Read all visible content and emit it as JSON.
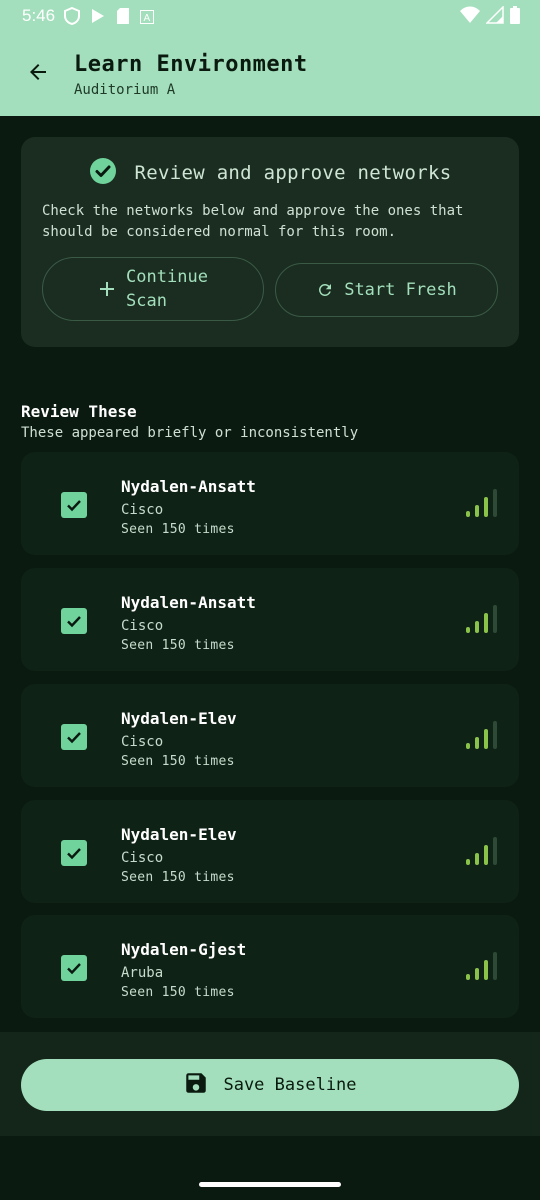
{
  "status_bar": {
    "time": "5:46",
    "icons_left": [
      "shield-icon",
      "play-store-icon",
      "sd-card-icon",
      "font-a-icon"
    ],
    "icons_right": [
      "wifi-icon",
      "cell-signal-icon",
      "battery-icon"
    ]
  },
  "app_bar": {
    "back_icon": "arrow-back-icon",
    "title": "Learn Environment",
    "subtitle": "Auditorium A"
  },
  "review_card": {
    "icon": "check-circle-icon",
    "title": "Review and approve networks",
    "description": "Check the networks below and approve the ones that should be considered normal for this room.",
    "continue_label_line1": "Continue",
    "continue_label_line2": "Scan",
    "start_fresh_label": "Start Fresh"
  },
  "section": {
    "title": "Review These",
    "subtitle": "These appeared briefly or inconsistently"
  },
  "networks": [
    {
      "name": "Nydalen-Ansatt",
      "vendor": "Cisco",
      "seen": "Seen 150 times",
      "checked": true,
      "signal_level": 3
    },
    {
      "name": "Nydalen-Ansatt",
      "vendor": "Cisco",
      "seen": "Seen 150 times",
      "checked": true,
      "signal_level": 3
    },
    {
      "name": "Nydalen-Elev",
      "vendor": "Cisco",
      "seen": "Seen 150 times",
      "checked": true,
      "signal_level": 3
    },
    {
      "name": "Nydalen-Elev",
      "vendor": "Cisco",
      "seen": "Seen 150 times",
      "checked": true,
      "signal_level": 3
    },
    {
      "name": "Nydalen-Gjest",
      "vendor": "Aruba",
      "seen": "Seen 150 times",
      "checked": true,
      "signal_level": 3
    }
  ],
  "footer": {
    "save_icon": "save-icon",
    "save_label": "Save Baseline"
  },
  "colors": {
    "accent": "#a3dfbc",
    "background": "#0b1a10",
    "checkbox": "#6fd39b",
    "signal_active": "#8bc34a",
    "signal_inactive": "#2e4a37"
  }
}
